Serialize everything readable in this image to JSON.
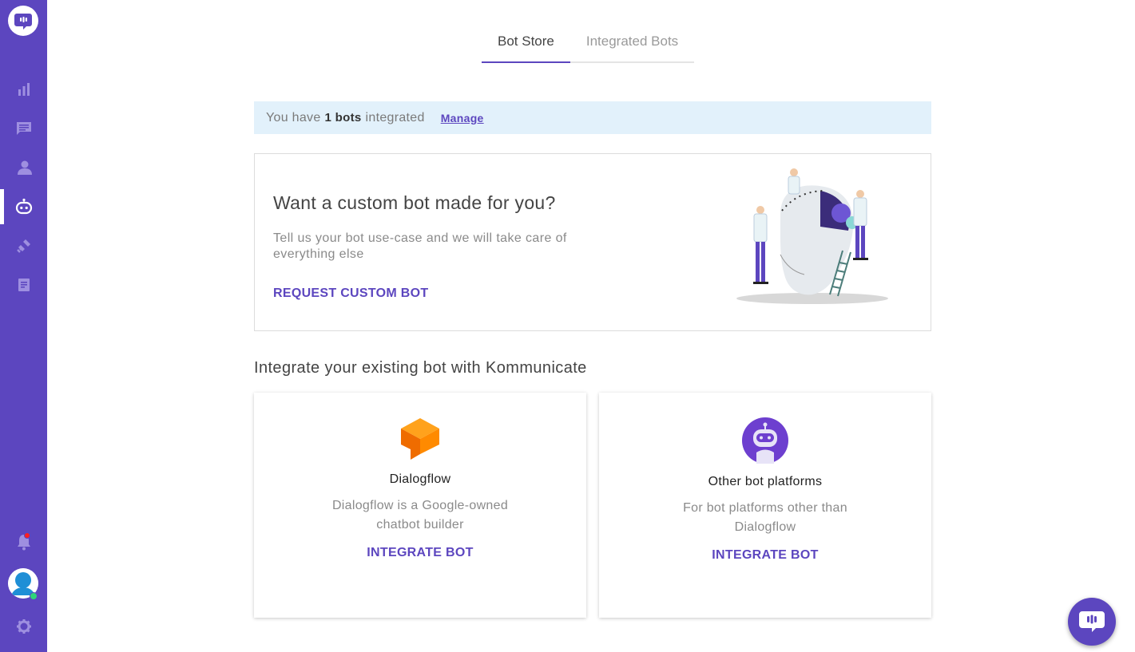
{
  "colors": {
    "brand": "#5c46bf",
    "banner_bg": "#e2f1fb",
    "dialogflow_orange": "#ff8a00",
    "notification": "#ff1f1f",
    "online": "#2ed47a"
  },
  "sidebar": {
    "logo_icon": "chat-logo-icon",
    "items": [
      {
        "icon": "bar-chart-icon",
        "active": false
      },
      {
        "icon": "conversations-icon",
        "active": false
      },
      {
        "icon": "users-icon",
        "active": false
      },
      {
        "icon": "bot-icon",
        "active": true
      },
      {
        "icon": "integrations-icon",
        "active": false
      },
      {
        "icon": "reports-icon",
        "active": false
      }
    ],
    "bottom": [
      "bell-icon",
      "avatar",
      "gear-icon"
    ]
  },
  "tabs": [
    {
      "label": "Bot Store",
      "active": true
    },
    {
      "label": "Integrated Bots",
      "active": false
    }
  ],
  "banner": {
    "prefix": "You have",
    "count": "1 bots",
    "suffix": "integrated",
    "manage": "Manage"
  },
  "custom_bot": {
    "title": "Want a custom bot made for you?",
    "description": "Tell us your bot use-case and we will take care of everything else",
    "button": "REQUEST CUSTOM BOT"
  },
  "integrate_section": {
    "title": "Integrate your existing bot with Kommunicate",
    "cards": [
      {
        "name": "Dialogflow",
        "description": "Dialogflow is a Google-owned chatbot builder",
        "button": "INTEGRATE BOT",
        "icon": "dialogflow-icon"
      },
      {
        "name": "Other bot platforms",
        "description": "For bot platforms other than Dialogflow",
        "button": "INTEGRATE BOT",
        "icon": "robot-icon"
      }
    ]
  },
  "chat_widget": {
    "icon": "chat-widget-icon"
  }
}
